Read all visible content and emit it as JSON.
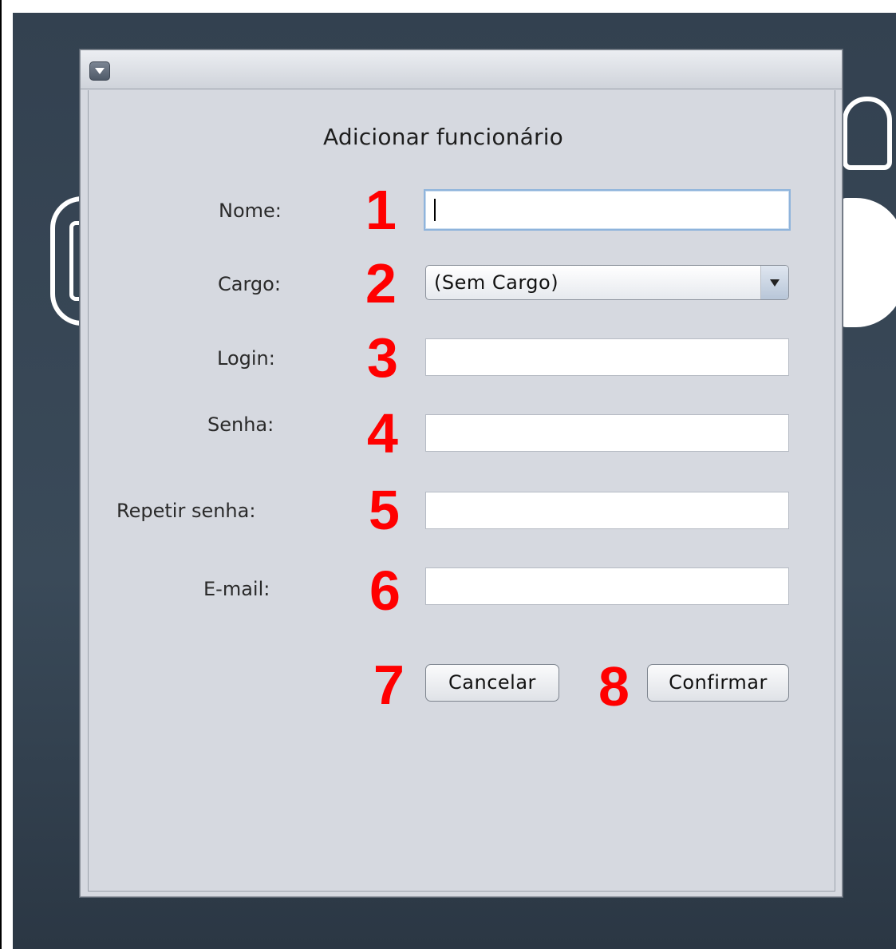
{
  "dialog": {
    "title": "Adicionar funcionário"
  },
  "fields": {
    "nome": {
      "label": "Nome:",
      "value": "",
      "marker": "1"
    },
    "cargo": {
      "label": "Cargo:",
      "selected": "(Sem Cargo)",
      "marker": "2"
    },
    "login": {
      "label": "Login:",
      "value": "",
      "marker": "3"
    },
    "senha": {
      "label": "Senha:",
      "value": "",
      "marker": "4"
    },
    "repetir_senha": {
      "label": "Repetir senha:",
      "value": "",
      "marker": "5"
    },
    "email": {
      "label": "E-mail:",
      "value": "",
      "marker": "6"
    }
  },
  "buttons": {
    "cancelar": {
      "label": "Cancelar",
      "marker": "7"
    },
    "confirmar": {
      "label": "Confirmar",
      "marker": "8"
    }
  },
  "colors": {
    "marker": "#ff0000",
    "desktop": "#334150",
    "dialog_bg": "#d6d9e0",
    "focus_ring": "#8fb4dc"
  },
  "icons": {
    "window_menu": "chevron-down-icon",
    "combo_arrow": "dropdown-arrow-icon"
  }
}
